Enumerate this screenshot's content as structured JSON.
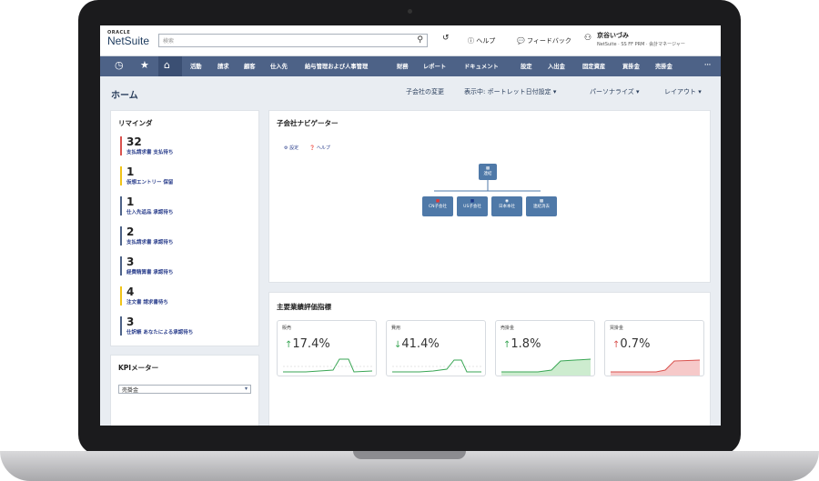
{
  "header": {
    "logo_oracle": "ORACLE",
    "logo_netsuite": "NetSuite",
    "search_placeholder": "検索",
    "help": "ヘルプ",
    "feedback": "フィードバック",
    "user_name": "京谷いづみ",
    "user_role": "NetSuite · SS FF PRM · 会計マネージャー"
  },
  "nav": {
    "items": [
      "活動",
      "請求",
      "顧客",
      "仕入先",
      "給与管理および人事管理",
      "財務",
      "レポート",
      "ドキュメント",
      "設定",
      "入出金",
      "固定資産",
      "買掛金",
      "売掛金"
    ],
    "more": "···"
  },
  "page": {
    "title": "ホーム",
    "links": [
      "子会社の変更",
      "表示中: ポートレット日付設定",
      "パーソナライズ",
      "レイアウト"
    ]
  },
  "reminders": {
    "title": "リマインダ",
    "items": [
      {
        "count": "32",
        "label": "支払請求書 支払待ち",
        "color": "#d9534f"
      },
      {
        "count": "1",
        "label": "仮想エントリー 保留",
        "color": "#f0c419"
      },
      {
        "count": "1",
        "label": "仕入先返品 承認待ち",
        "color": "#4d6287"
      },
      {
        "count": "2",
        "label": "支払請求書 承認待ち",
        "color": "#4d6287"
      },
      {
        "count": "3",
        "label": "経費精算書 承認待ち",
        "color": "#4d6287"
      },
      {
        "count": "4",
        "label": "注文書 請求書待ち",
        "color": "#f0c419"
      },
      {
        "count": "3",
        "label": "仕訳帳 あなたによる承認待ち",
        "color": "#4d6287"
      }
    ]
  },
  "kpi_meter": {
    "title": "KPIメーター",
    "select_value": "売掛金"
  },
  "subsidiary_nav": {
    "title": "子会社ナビゲーター",
    "settings": "設定",
    "help": "ヘルプ",
    "root_label": "連結",
    "children": [
      "CN子会社",
      "US子会社",
      "日本本社",
      "連結消去"
    ]
  },
  "kpi_scorecard": {
    "title": "主要業績評価指標",
    "cards": [
      {
        "label": "販売",
        "value": "17.4%",
        "direction": "up",
        "color": "#3aa655"
      },
      {
        "label": "費用",
        "value": "41.4%",
        "direction": "down",
        "color": "#3aa655"
      },
      {
        "label": "売掛金",
        "value": "1.8%",
        "direction": "up",
        "color": "#3aa655"
      },
      {
        "label": "買掛金",
        "value": "0.7%",
        "direction": "up",
        "color": "#d9534f"
      }
    ]
  }
}
